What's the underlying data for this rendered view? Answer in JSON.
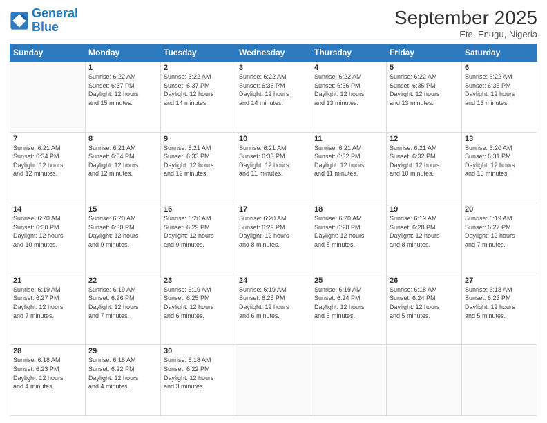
{
  "logo": {
    "line1": "General",
    "line2": "Blue"
  },
  "title": "September 2025",
  "subtitle": "Ete, Enugu, Nigeria",
  "weekdays": [
    "Sunday",
    "Monday",
    "Tuesday",
    "Wednesday",
    "Thursday",
    "Friday",
    "Saturday"
  ],
  "weeks": [
    [
      {
        "day": "",
        "info": ""
      },
      {
        "day": "1",
        "info": "Sunrise: 6:22 AM\nSunset: 6:37 PM\nDaylight: 12 hours\nand 15 minutes."
      },
      {
        "day": "2",
        "info": "Sunrise: 6:22 AM\nSunset: 6:37 PM\nDaylight: 12 hours\nand 14 minutes."
      },
      {
        "day": "3",
        "info": "Sunrise: 6:22 AM\nSunset: 6:36 PM\nDaylight: 12 hours\nand 14 minutes."
      },
      {
        "day": "4",
        "info": "Sunrise: 6:22 AM\nSunset: 6:36 PM\nDaylight: 12 hours\nand 13 minutes."
      },
      {
        "day": "5",
        "info": "Sunrise: 6:22 AM\nSunset: 6:35 PM\nDaylight: 12 hours\nand 13 minutes."
      },
      {
        "day": "6",
        "info": "Sunrise: 6:22 AM\nSunset: 6:35 PM\nDaylight: 12 hours\nand 13 minutes."
      }
    ],
    [
      {
        "day": "7",
        "info": "Sunrise: 6:21 AM\nSunset: 6:34 PM\nDaylight: 12 hours\nand 12 minutes."
      },
      {
        "day": "8",
        "info": "Sunrise: 6:21 AM\nSunset: 6:34 PM\nDaylight: 12 hours\nand 12 minutes."
      },
      {
        "day": "9",
        "info": "Sunrise: 6:21 AM\nSunset: 6:33 PM\nDaylight: 12 hours\nand 12 minutes."
      },
      {
        "day": "10",
        "info": "Sunrise: 6:21 AM\nSunset: 6:33 PM\nDaylight: 12 hours\nand 11 minutes."
      },
      {
        "day": "11",
        "info": "Sunrise: 6:21 AM\nSunset: 6:32 PM\nDaylight: 12 hours\nand 11 minutes."
      },
      {
        "day": "12",
        "info": "Sunrise: 6:21 AM\nSunset: 6:32 PM\nDaylight: 12 hours\nand 10 minutes."
      },
      {
        "day": "13",
        "info": "Sunrise: 6:20 AM\nSunset: 6:31 PM\nDaylight: 12 hours\nand 10 minutes."
      }
    ],
    [
      {
        "day": "14",
        "info": "Sunrise: 6:20 AM\nSunset: 6:30 PM\nDaylight: 12 hours\nand 10 minutes."
      },
      {
        "day": "15",
        "info": "Sunrise: 6:20 AM\nSunset: 6:30 PM\nDaylight: 12 hours\nand 9 minutes."
      },
      {
        "day": "16",
        "info": "Sunrise: 6:20 AM\nSunset: 6:29 PM\nDaylight: 12 hours\nand 9 minutes."
      },
      {
        "day": "17",
        "info": "Sunrise: 6:20 AM\nSunset: 6:29 PM\nDaylight: 12 hours\nand 8 minutes."
      },
      {
        "day": "18",
        "info": "Sunrise: 6:20 AM\nSunset: 6:28 PM\nDaylight: 12 hours\nand 8 minutes."
      },
      {
        "day": "19",
        "info": "Sunrise: 6:19 AM\nSunset: 6:28 PM\nDaylight: 12 hours\nand 8 minutes."
      },
      {
        "day": "20",
        "info": "Sunrise: 6:19 AM\nSunset: 6:27 PM\nDaylight: 12 hours\nand 7 minutes."
      }
    ],
    [
      {
        "day": "21",
        "info": "Sunrise: 6:19 AM\nSunset: 6:27 PM\nDaylight: 12 hours\nand 7 minutes."
      },
      {
        "day": "22",
        "info": "Sunrise: 6:19 AM\nSunset: 6:26 PM\nDaylight: 12 hours\nand 7 minutes."
      },
      {
        "day": "23",
        "info": "Sunrise: 6:19 AM\nSunset: 6:25 PM\nDaylight: 12 hours\nand 6 minutes."
      },
      {
        "day": "24",
        "info": "Sunrise: 6:19 AM\nSunset: 6:25 PM\nDaylight: 12 hours\nand 6 minutes."
      },
      {
        "day": "25",
        "info": "Sunrise: 6:19 AM\nSunset: 6:24 PM\nDaylight: 12 hours\nand 5 minutes."
      },
      {
        "day": "26",
        "info": "Sunrise: 6:18 AM\nSunset: 6:24 PM\nDaylight: 12 hours\nand 5 minutes."
      },
      {
        "day": "27",
        "info": "Sunrise: 6:18 AM\nSunset: 6:23 PM\nDaylight: 12 hours\nand 5 minutes."
      }
    ],
    [
      {
        "day": "28",
        "info": "Sunrise: 6:18 AM\nSunset: 6:23 PM\nDaylight: 12 hours\nand 4 minutes."
      },
      {
        "day": "29",
        "info": "Sunrise: 6:18 AM\nSunset: 6:22 PM\nDaylight: 12 hours\nand 4 minutes."
      },
      {
        "day": "30",
        "info": "Sunrise: 6:18 AM\nSunset: 6:22 PM\nDaylight: 12 hours\nand 3 minutes."
      },
      {
        "day": "",
        "info": ""
      },
      {
        "day": "",
        "info": ""
      },
      {
        "day": "",
        "info": ""
      },
      {
        "day": "",
        "info": ""
      }
    ]
  ]
}
